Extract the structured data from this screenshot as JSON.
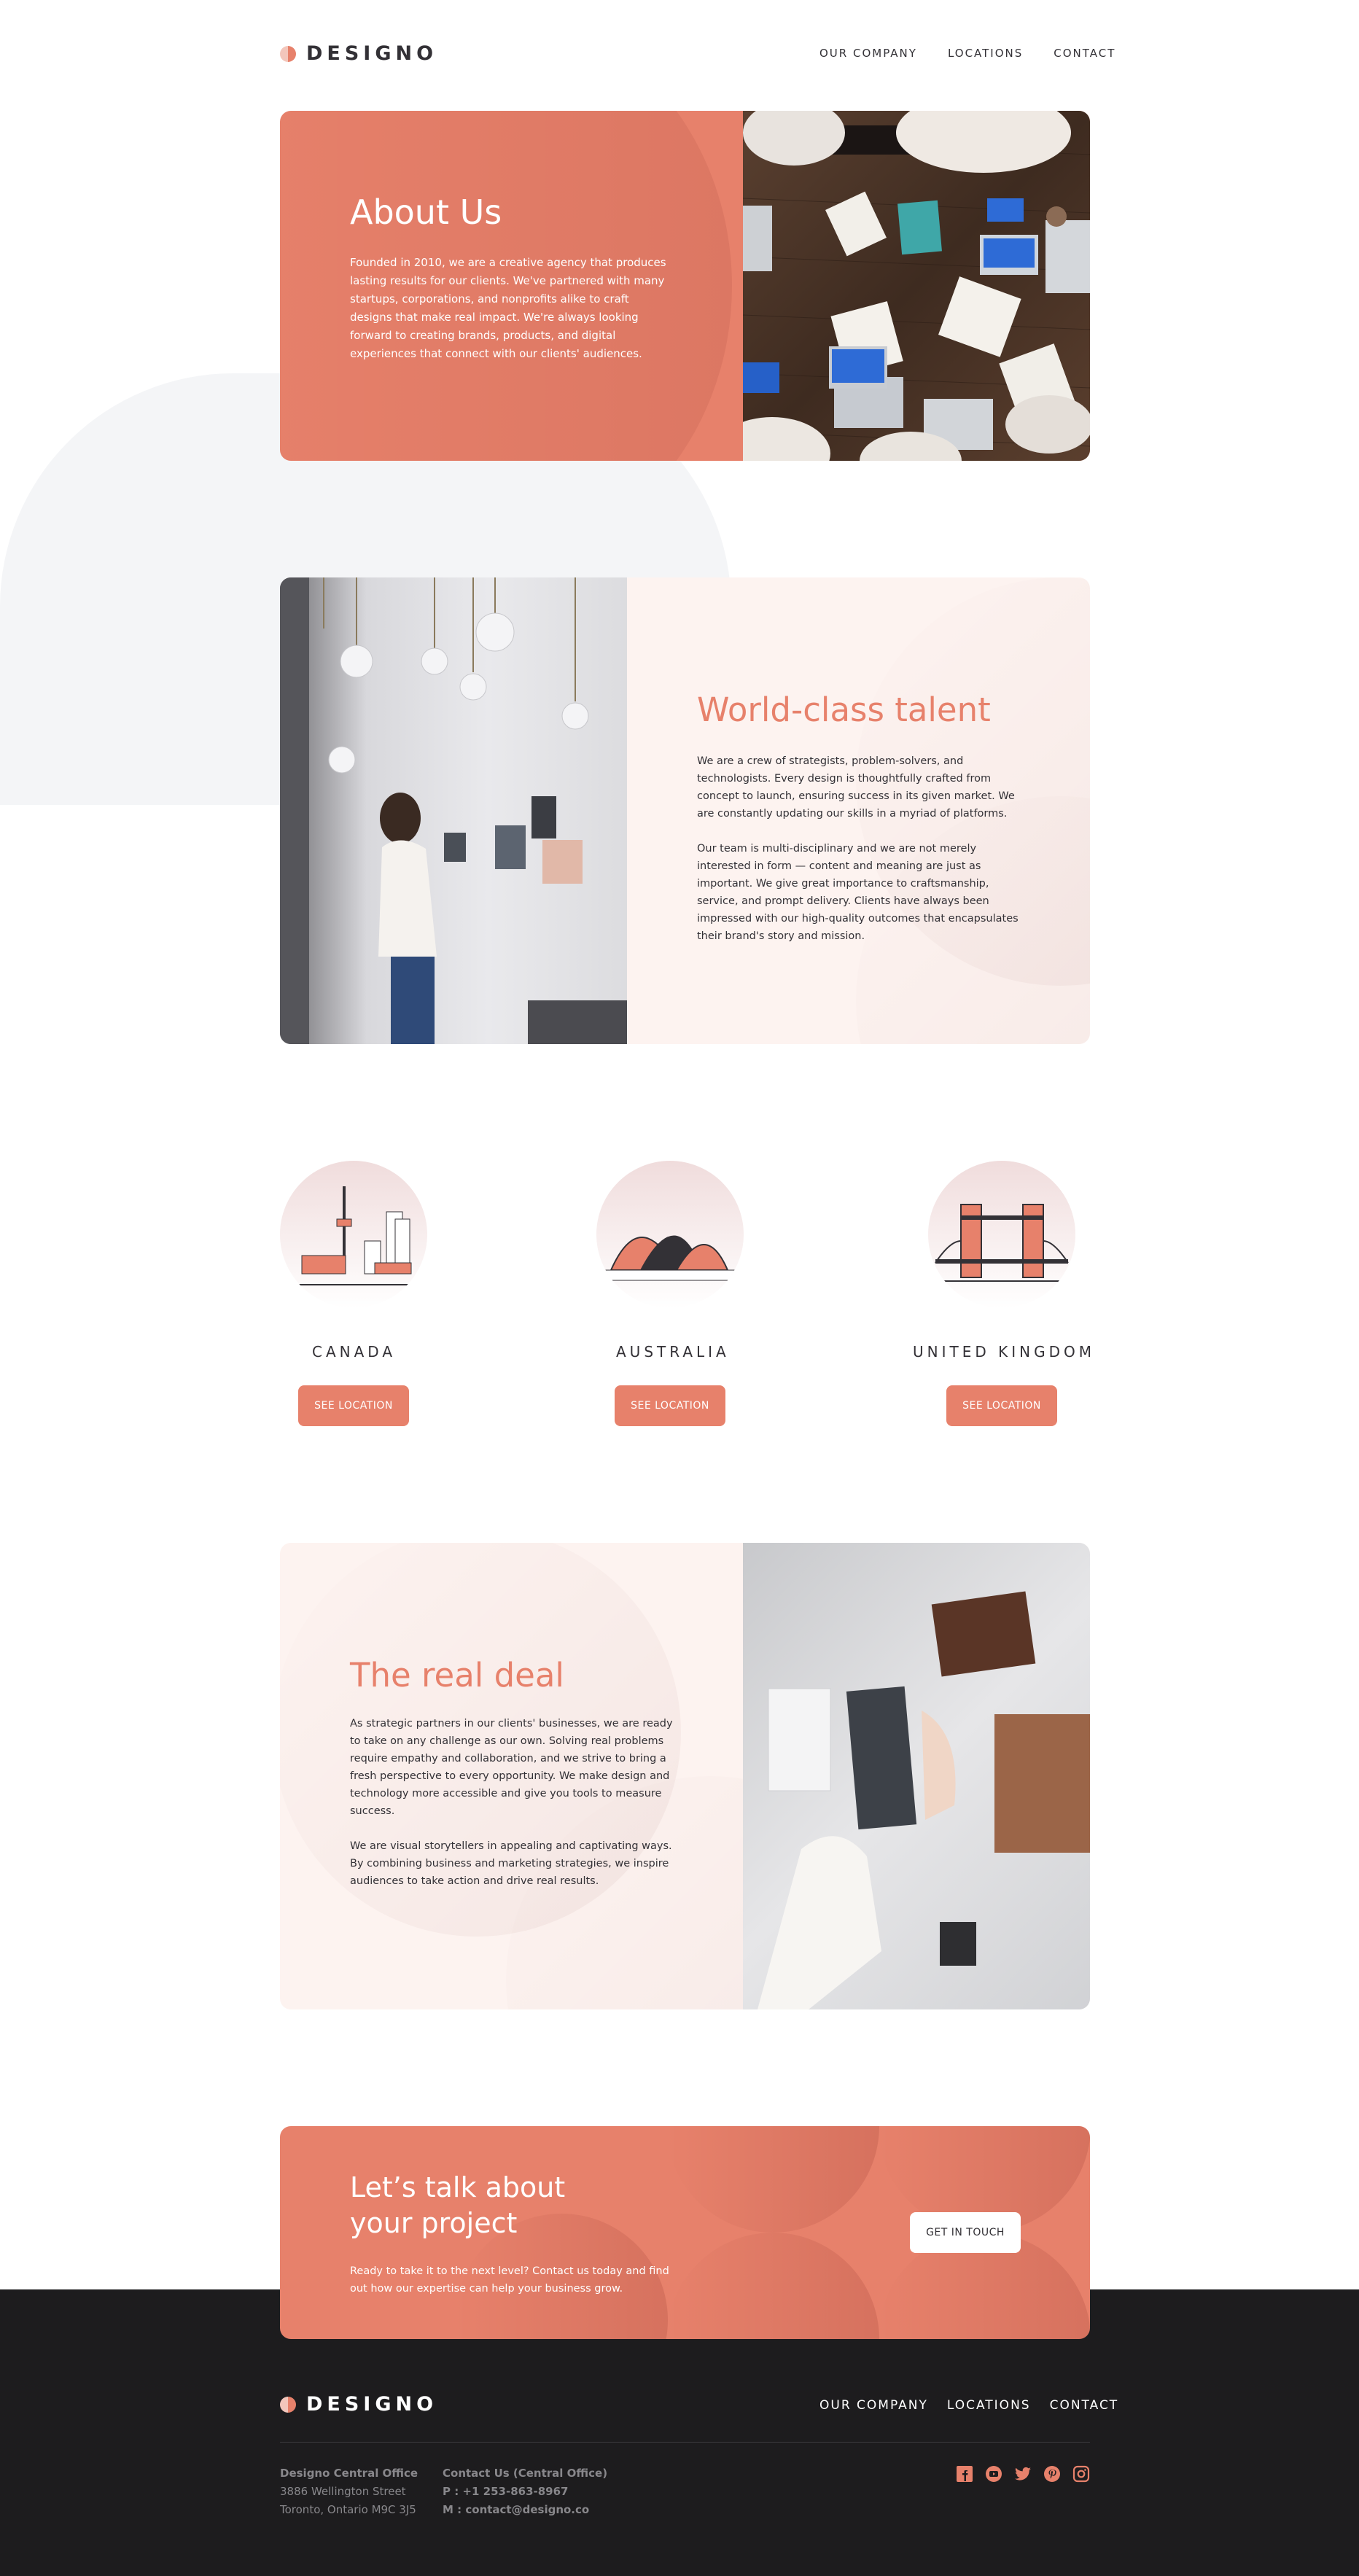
{
  "brand": {
    "name": "DESIGNO"
  },
  "nav": {
    "company": "OUR COMPANY",
    "locations": "LOCATIONS",
    "contact": "CONTACT"
  },
  "hero": {
    "title": "About Us",
    "body": "Founded in 2010, we are a creative agency that produces lasting results for our clients. We've partnered with many startups, corporations, and nonprofits alike to craft designs that make real impact. We're always looking forward to creating brands, products, and digital experiences that connect with our clients' audiences."
  },
  "talent": {
    "title": "World-class talent",
    "p1": "We are a crew of strategists, problem-solvers, and technologists. Every design is thoughtfully crafted from concept to launch, ensuring success in its given market. We are constantly updating our skills in a myriad of platforms.",
    "p2": "Our team is multi-disciplinary and we are not merely interested in form — content and meaning are just as important. We give great importance to craftsmanship, service, and prompt delivery. Clients have always been impressed with our high-quality outcomes that encapsulates their brand's story and mission."
  },
  "locations": [
    {
      "name": "CANADA",
      "button": "SEE LOCATION"
    },
    {
      "name": "AUSTRALIA",
      "button": "SEE LOCATION"
    },
    {
      "name": "UNITED KINGDOM",
      "button": "SEE LOCATION"
    }
  ],
  "deal": {
    "title": "The real deal",
    "p1": "As strategic partners in our clients' businesses, we are ready to take on any challenge as our own. Solving real problems require empathy and collaboration, and we strive to bring a fresh perspective to every opportunity. We make design and technology more accessible and give you tools to measure success.",
    "p2": "We are visual storytellers in appealing and captivating ways. By combining business and marketing strategies, we inspire audiences to take action and drive real results."
  },
  "cta": {
    "title": "Let’s talk about your project",
    "body": "Ready to take it to the next level? Contact us today and find out how our expertise can help your business grow.",
    "button": "GET IN TOUCH"
  },
  "footer": {
    "office_title": "Designo Central Office",
    "address1": "3886 Wellington Street",
    "address2": "Toronto, Ontario M9C 3J5",
    "contact_title": "Contact Us (Central Office)",
    "phone": "P : +1 253-863-8967",
    "email": "M : contact@designo.co"
  },
  "colors": {
    "accent": "#e7816b",
    "dark": "#1d1c1e",
    "peach": "#fdf3f0",
    "text": "#333136"
  },
  "icons": [
    "facebook-icon",
    "youtube-icon",
    "twitter-icon",
    "pinterest-icon",
    "instagram-icon"
  ]
}
